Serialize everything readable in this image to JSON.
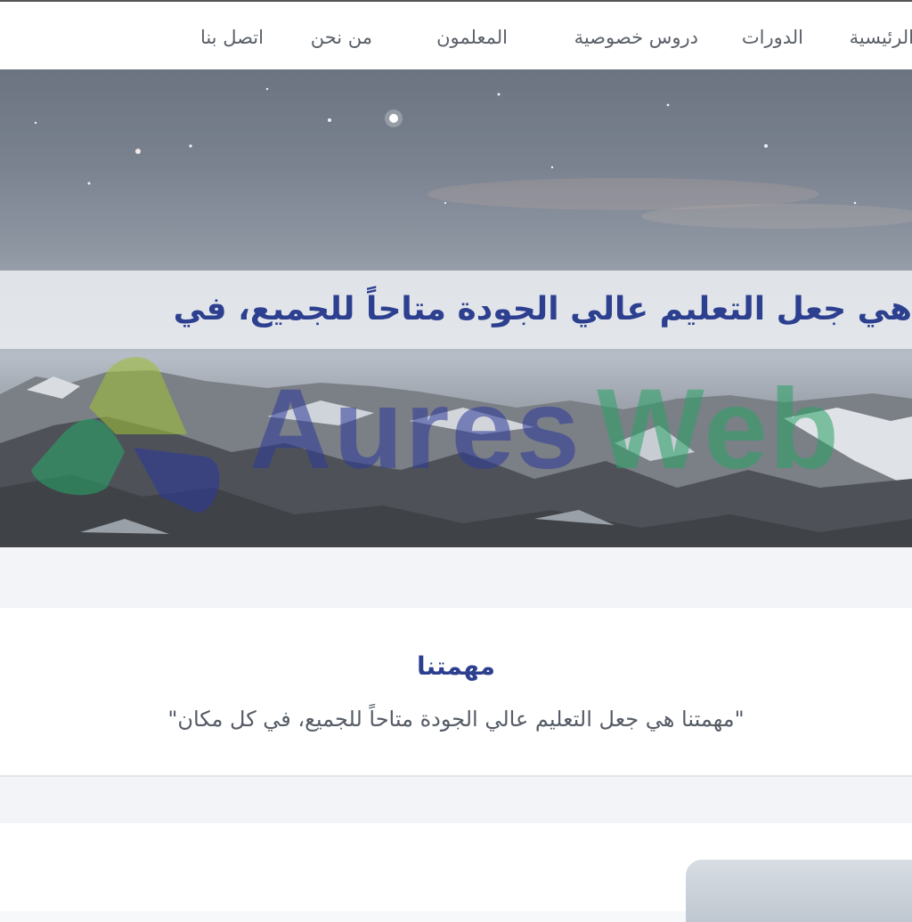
{
  "nav": {
    "items": [
      {
        "label": "الرئيسية"
      },
      {
        "label": "الدورات"
      },
      {
        "label": "دروس خصوصية"
      },
      {
        "label": "المعلمون"
      },
      {
        "label": "من نحن"
      },
      {
        "label": "اتصل بنا"
      }
    ]
  },
  "hero": {
    "banner_text": "هي جعل التعليم عالي الجودة متاحاً للجميع، في"
  },
  "watermark": {
    "text_part1": "Aures",
    "text_part2": "Web"
  },
  "mission": {
    "title": "مهمتنا",
    "quote": "\"مهمتنا هي جعل التعليم عالي الجودة متاحاً للجميع، في كل مكان\""
  },
  "colors": {
    "brand_blue": "#2d3f8f",
    "nav_text": "#5a6068",
    "watermark_blue": "#2e3a9a",
    "watermark_green": "#2aa267",
    "watermark_lime": "#9cbd3a"
  }
}
